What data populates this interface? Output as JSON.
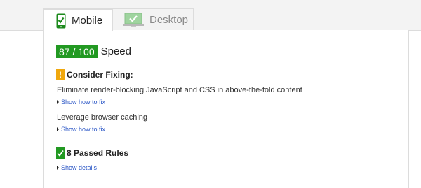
{
  "tabs": {
    "mobile": {
      "label": "Mobile",
      "icon": "phone-check-icon",
      "active": true
    },
    "desktop": {
      "label": "Desktop",
      "icon": "monitor-check-icon",
      "active": false
    }
  },
  "score": {
    "value": "87 / 100",
    "label": "Speed",
    "color": "#229922"
  },
  "consider_fixing": {
    "icon": "warning-icon",
    "icon_glyph": "!",
    "title": "Consider Fixing:",
    "color": "#f0a80e",
    "rules": [
      {
        "text": "Eliminate render-blocking JavaScript and CSS in above-the-fold content",
        "link": "Show how to fix"
      },
      {
        "text": "Leverage browser caching",
        "link": "Show how to fix"
      }
    ]
  },
  "passed": {
    "icon": "check-icon",
    "title": "8 Passed Rules",
    "link": "Show details",
    "color": "#229922"
  },
  "link_color": "#2a56c6"
}
